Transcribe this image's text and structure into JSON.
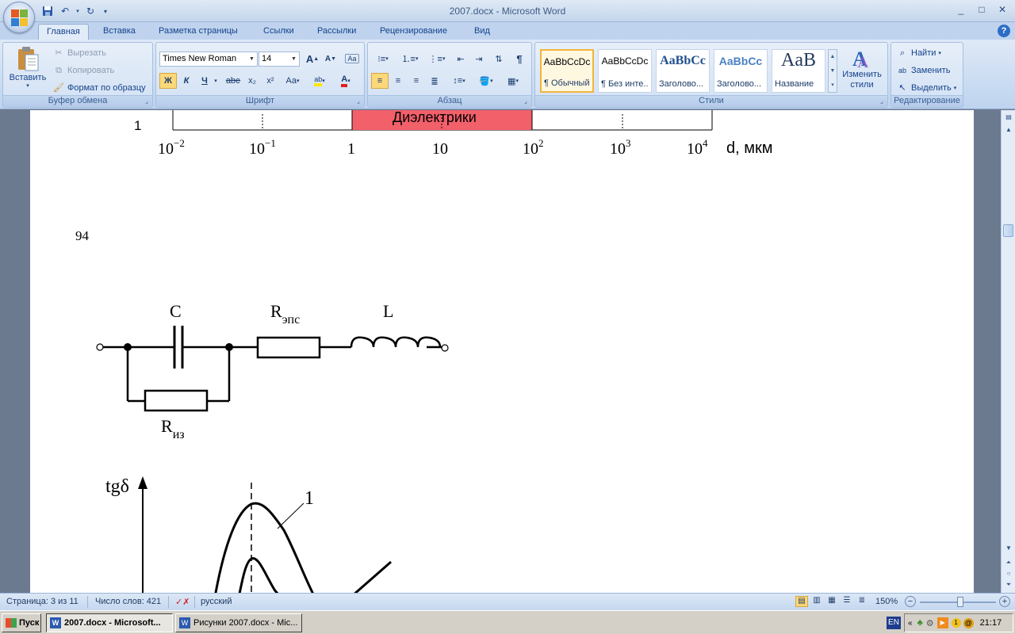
{
  "window": {
    "title": "2007.docx - Microsoft Word",
    "controls": [
      "_",
      "□",
      "✕"
    ]
  },
  "tabs": [
    "Главная",
    "Вставка",
    "Разметка страницы",
    "Ссылки",
    "Рассылки",
    "Рецензирование",
    "Вид"
  ],
  "active_tab": "Главная",
  "ribbon": {
    "clipboard": {
      "label": "Буфер обмена",
      "paste": "Вставить",
      "cut": "Вырезать",
      "copy": "Копировать",
      "format_painter": "Формат по образцу"
    },
    "font": {
      "label": "Шрифт",
      "font_name": "Times New Roman",
      "font_size": "14",
      "bold": "Ж",
      "italic": "К",
      "underline": "Ч",
      "strike": "abe",
      "subscript": "x₂",
      "superscript": "x²",
      "change_case": "Aa",
      "grow": "A",
      "shrink": "A"
    },
    "paragraph": {
      "label": "Абзац",
      "pilcrow": "¶"
    },
    "styles": {
      "label": "Стили",
      "items": [
        {
          "sample": "AaBbCcDc",
          "name": "¶ Обычный"
        },
        {
          "sample": "AaBbCcDc",
          "name": "¶ Без инте..."
        },
        {
          "sample": "AaBbCc",
          "name": "Заголово..."
        },
        {
          "sample": "AaBbCc",
          "name": "Заголово..."
        },
        {
          "sample": "AaB",
          "name": "Название"
        }
      ],
      "change_styles": "Изменить стили"
    },
    "editing": {
      "label": "Редактирование",
      "find": "Найти",
      "replace": "Заменить",
      "select": "Выделить"
    }
  },
  "document": {
    "scale_row": {
      "left_marker": "1",
      "band_label": "Диэлектрики",
      "ticks": [
        "10",
        "10",
        "1",
        "10",
        "10",
        "10",
        "10"
      ],
      "exponents": [
        "−2",
        "−1",
        "",
        "",
        "2",
        "3",
        "4"
      ],
      "unit": "d, мкм"
    },
    "page_number": "94",
    "circuit": {
      "c_label": "C",
      "r_main": "R",
      "r_main_sub": "эпс",
      "l_label": "L",
      "r_iso": "R",
      "r_iso_sub": "из"
    },
    "graph": {
      "y_label": "tgδ",
      "curve_label": "1"
    }
  },
  "status": {
    "page": "Страница: 3 из 11",
    "words": "Число слов: 421",
    "language": "русский",
    "zoom": "150%"
  },
  "taskbar": {
    "start": "Пуск",
    "items": [
      {
        "label": "2007.docx - Microsoft...",
        "active": true
      },
      {
        "label": "Рисунки 2007.docx - Mic...",
        "active": false
      }
    ],
    "lang": "EN",
    "time": "21:17"
  }
}
